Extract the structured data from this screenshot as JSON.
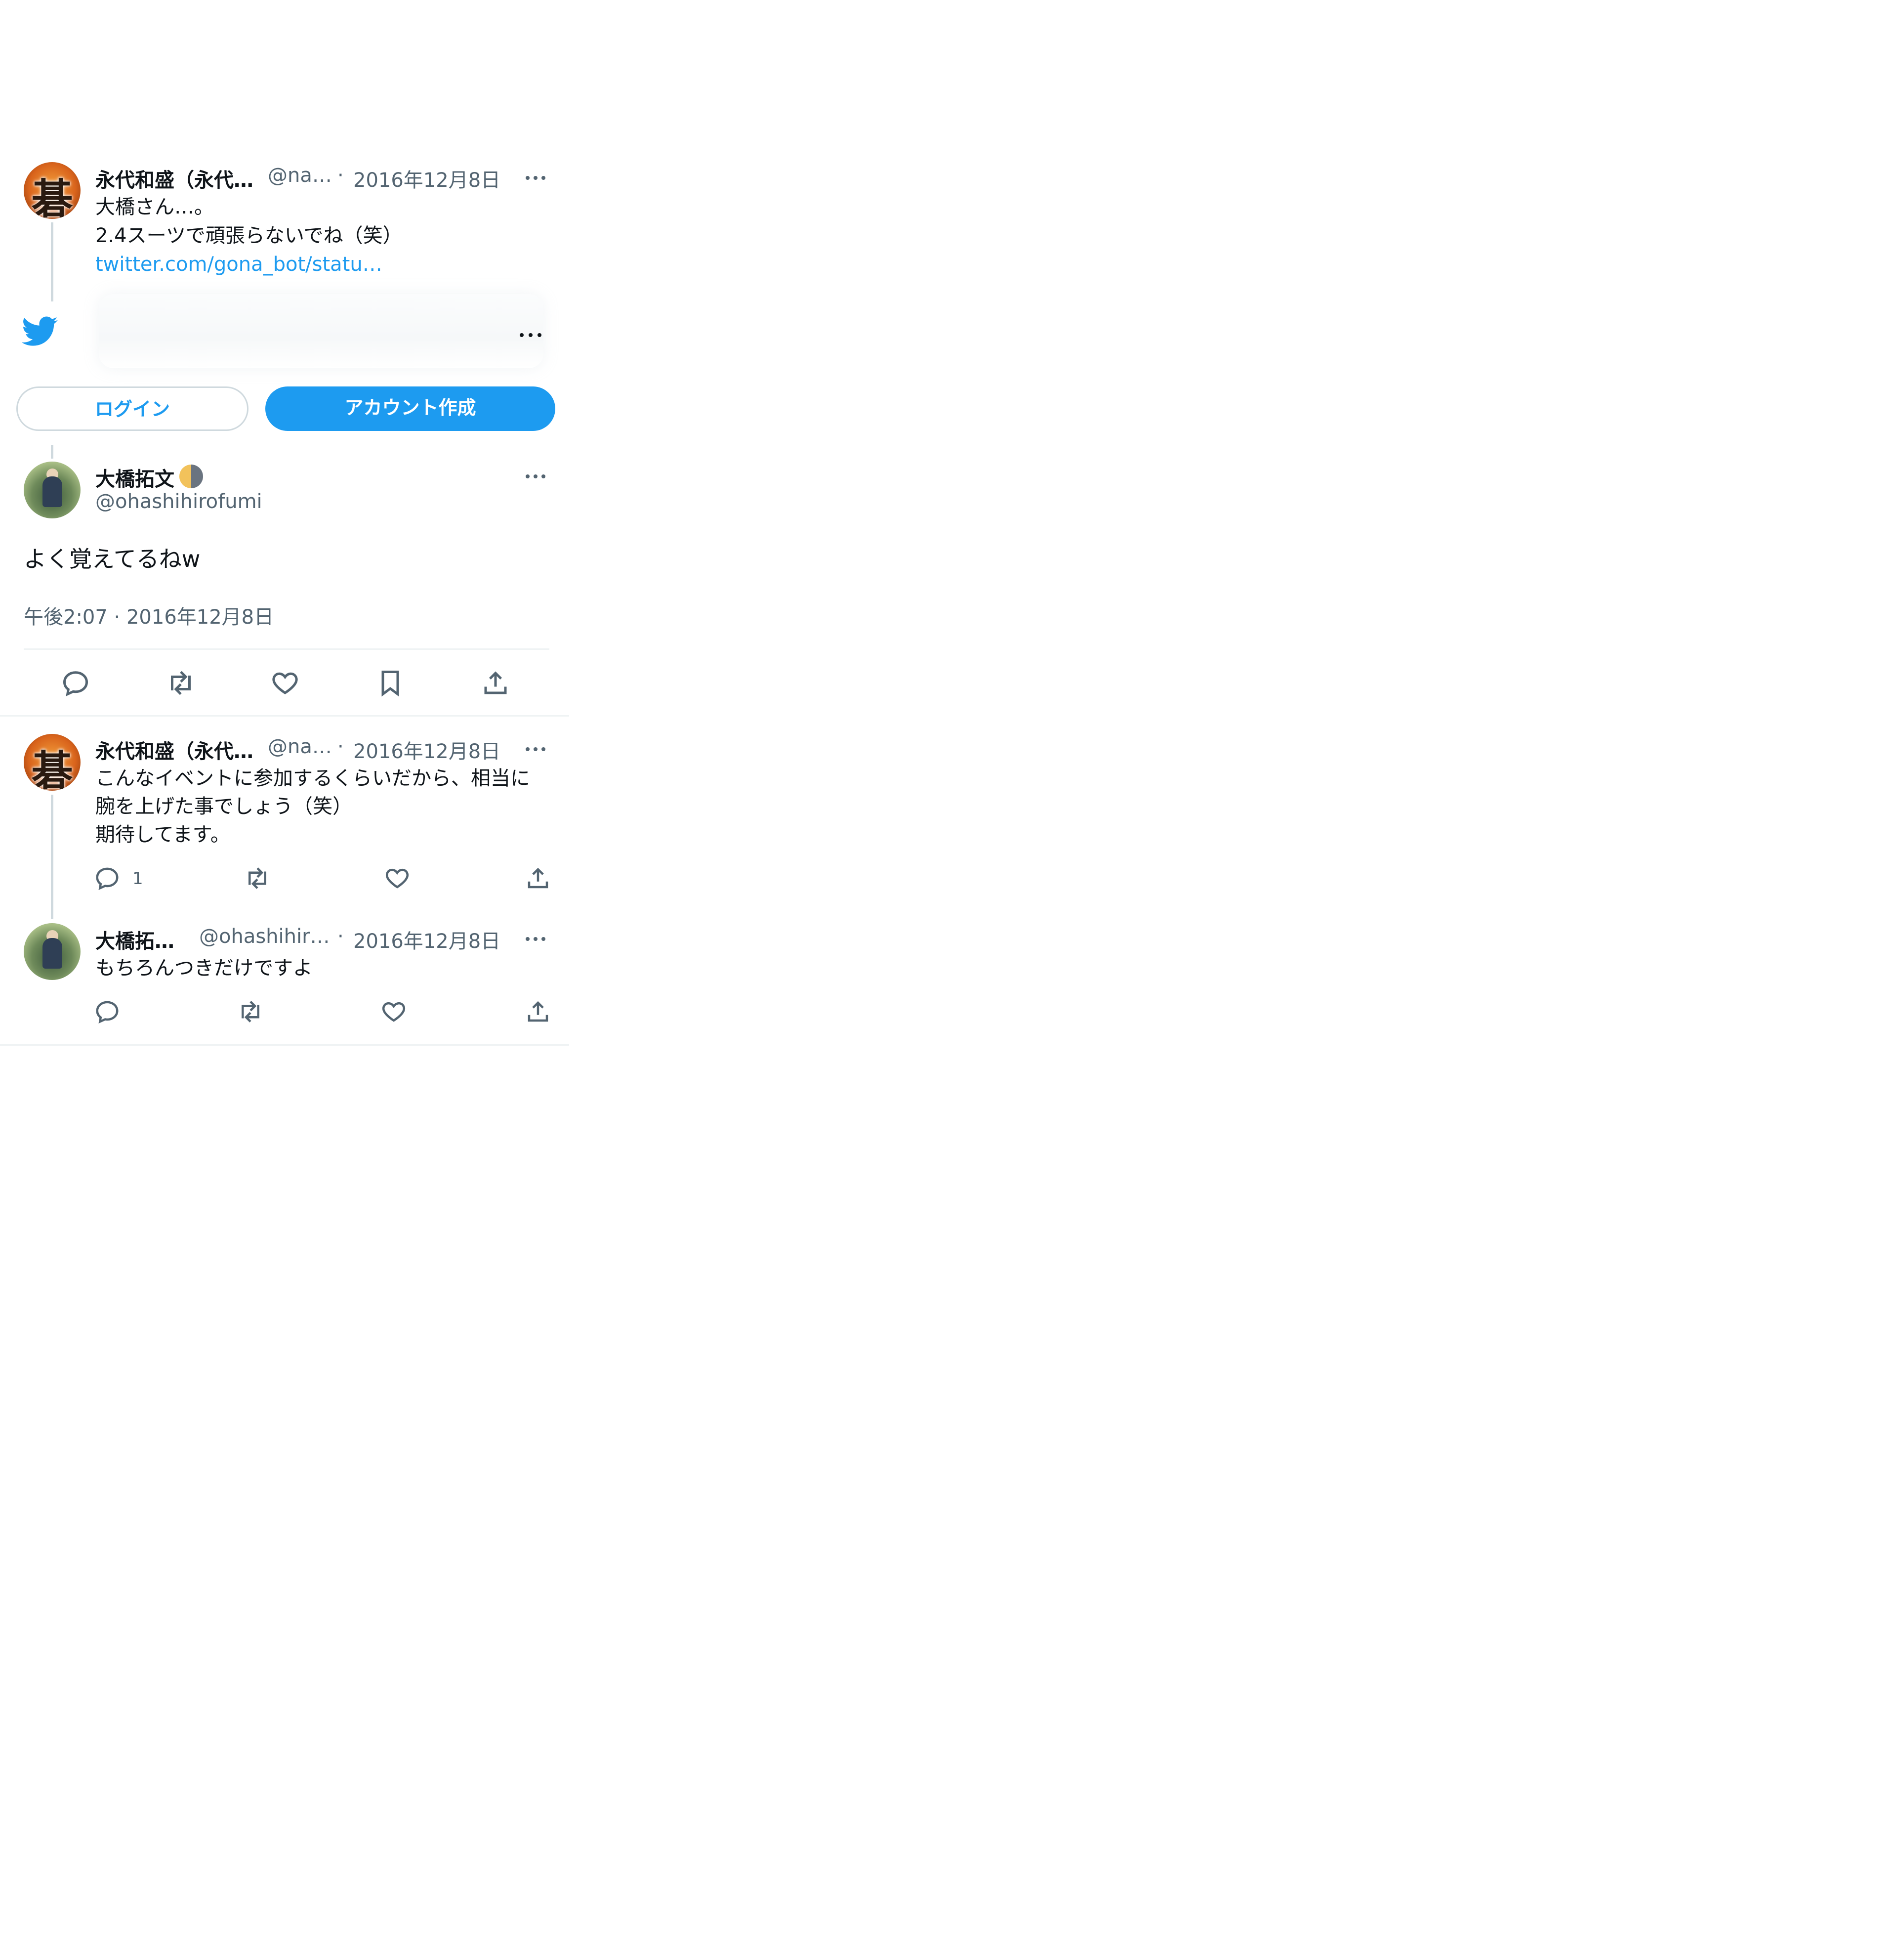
{
  "tweet1": {
    "name": "永代和盛（永代…",
    "handle": "@na…",
    "sep": "·",
    "date": "2016年12月8日",
    "line1": "大橋さん…。",
    "line2": "2.4スーツで頑張らないでね（笑）",
    "link": "twitter.com/gona_bot/statu…"
  },
  "auth": {
    "login_label": "ログイン",
    "signup_label": "アカウント作成"
  },
  "main": {
    "name": "大橋拓文",
    "handle": "@ohashihirofumi",
    "text": "よく覚えてるねw",
    "timestamp": "午後2:07 · 2016年12月8日"
  },
  "reply1": {
    "name": "永代和盛（永代…",
    "handle": "@na…",
    "sep": "·",
    "date": "2016年12月8日",
    "line1": "こんなイベントに参加するくらいだから、相当に",
    "line2": "腕を上げた事でしょう（笑）",
    "line3": "期待してます。",
    "reply_count": "1"
  },
  "reply2": {
    "name": "大橋拓…",
    "handle": "@ohashihir…",
    "sep": "·",
    "date": "2016年12月8日",
    "text": "もちろんつきだけですよ"
  },
  "colors": {
    "accent": "#1d9bf0",
    "text": "#0f1419",
    "muted": "#536471",
    "divider": "#eff3f4"
  }
}
